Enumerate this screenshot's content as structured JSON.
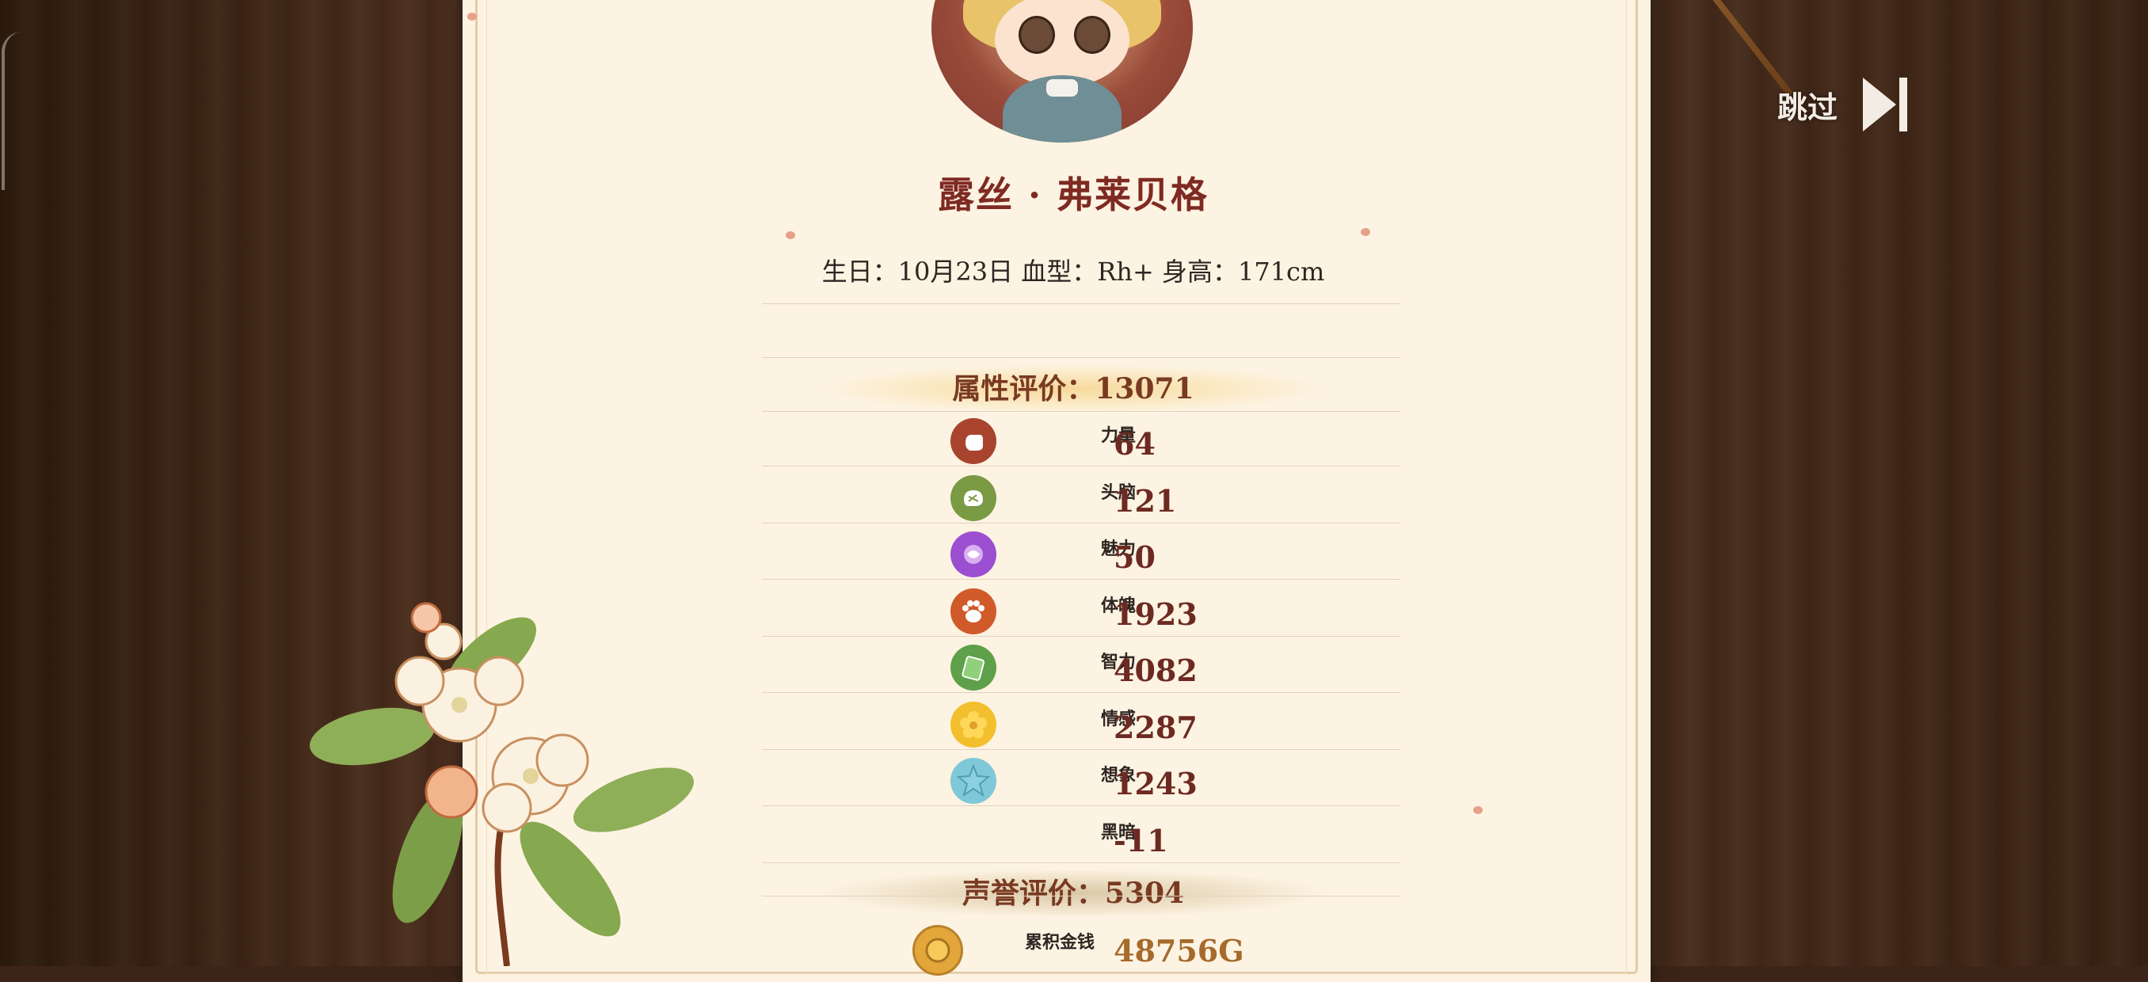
{
  "character": {
    "name": "露丝 · 弗莱贝格",
    "info_line": "生日：10月23日   血型：Rh+   身高：171cm"
  },
  "attribute_rating": {
    "label": "属性评价：13071"
  },
  "stats": [
    {
      "label": "力量",
      "value": "64",
      "icon": "fist-icon",
      "color": "#a8442e"
    },
    {
      "label": "头脑",
      "value": "121",
      "icon": "brain-icon",
      "color": "#7a9a44"
    },
    {
      "label": "魅力",
      "value": "50",
      "icon": "rose-icon",
      "color": "#9b4fd0"
    },
    {
      "label": "体魄",
      "value": "1923",
      "icon": "paw-icon",
      "color": "#d05a2a"
    },
    {
      "label": "智力",
      "value": "4082",
      "icon": "book-icon",
      "color": "#5fa04a"
    },
    {
      "label": "情感",
      "value": "2287",
      "icon": "flower-icon",
      "color": "#f2c02e"
    },
    {
      "label": "想象",
      "value": "1243",
      "icon": "star-icon",
      "color": "#7fc8d8"
    },
    {
      "label": "黑暗",
      "value": "-11",
      "icon": "",
      "color": ""
    }
  ],
  "fame_rating": {
    "label": "声誉评价：5304"
  },
  "money": {
    "label": "累积金钱",
    "value": "48756G",
    "icon": "coin-icon",
    "color": "#e2a63a"
  },
  "skip_button": {
    "label": "跳过"
  }
}
